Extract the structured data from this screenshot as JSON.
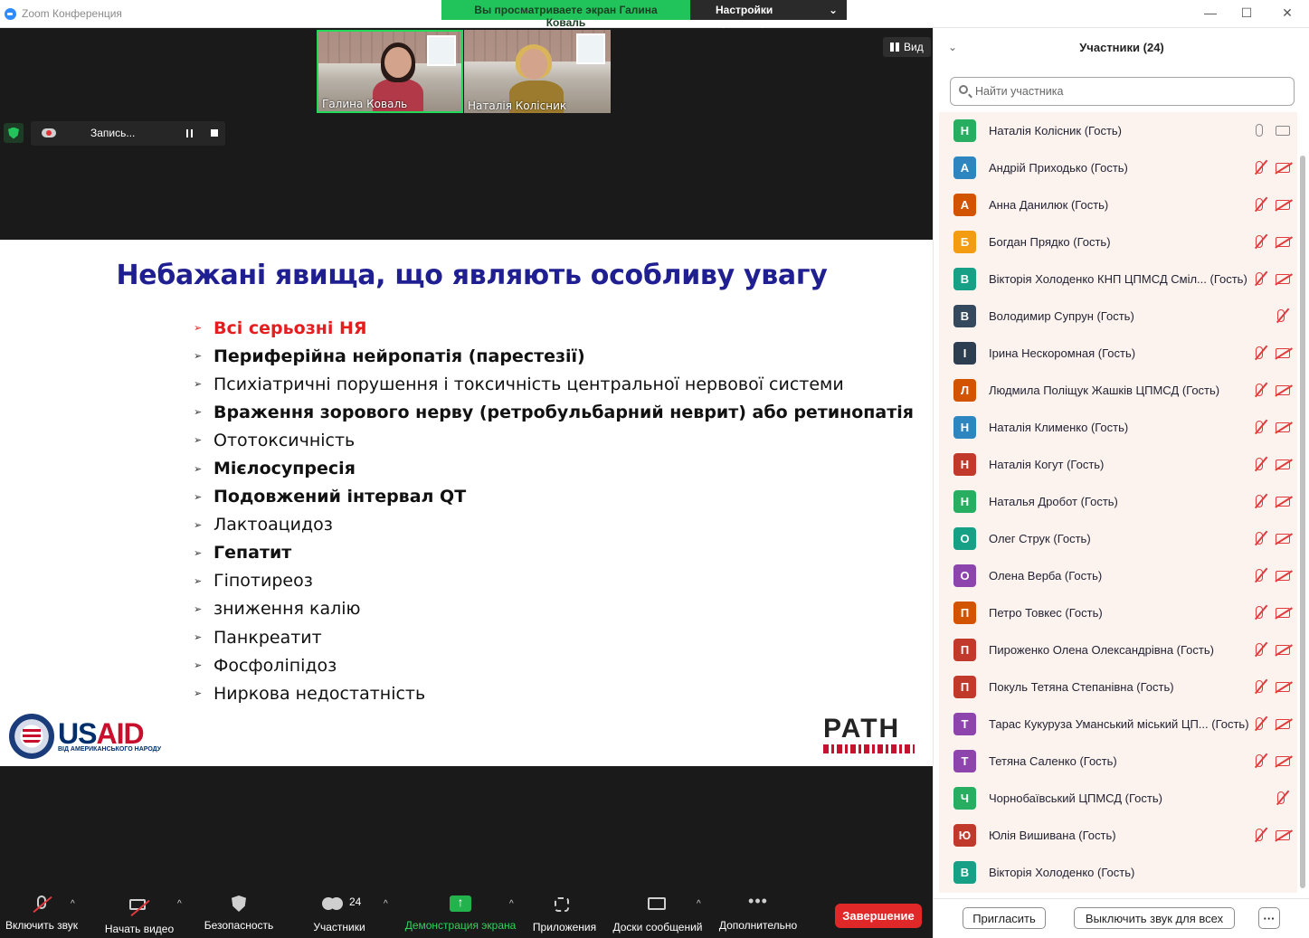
{
  "window": {
    "title": "Zoom Конференция",
    "share_banner": "Вы просматриваете экран Галина Коваль",
    "view_settings": "Настройки просмотра",
    "controls": {
      "minimize": "—",
      "maximize": "☐",
      "close": "✕"
    }
  },
  "video": {
    "view_label": "Вид",
    "thumbnails": [
      {
        "name": "Галина Коваль",
        "active": true
      },
      {
        "name": "Наталія Колісник",
        "active": false
      }
    ],
    "recording": {
      "label": "Запись..."
    }
  },
  "slide": {
    "title": "Небажані явища, що являють особливу увагу",
    "bullet": "➢",
    "items": [
      {
        "text": "Всі серьозні НЯ",
        "style": "red"
      },
      {
        "text": "Периферійна нейропатія (парестезії)",
        "style": "bold"
      },
      {
        "text": "Психіатричні порушення і токсичність центральної нервової системи",
        "style": "normal"
      },
      {
        "text": "Враження зорового нерву (ретробульбарний неврит) або ретинопатія",
        "style": "bold"
      },
      {
        "text": "Ототоксичність",
        "style": "normal"
      },
      {
        "text": "Мієлосупресія",
        "style": "bold"
      },
      {
        "text": "Подовжений інтервал QT",
        "style": "bold"
      },
      {
        "text": "Лактоацидоз",
        "style": "normal"
      },
      {
        "text": "Гепатит",
        "style": "bold"
      },
      {
        "text": "Гіпотиреоз",
        "style": "normal"
      },
      {
        "text": "зниження калію",
        "style": "normal"
      },
      {
        "text": "Панкреатит",
        "style": "normal"
      },
      {
        "text": "Фосфоліпідоз",
        "style": "normal"
      },
      {
        "text": "Ниркова недостатність",
        "style": "normal"
      }
    ],
    "usaid": {
      "word_a": "US",
      "word_b": "AID",
      "sub": "ВІД АМЕРИКАНСЬКОГО НАРОДУ"
    },
    "path": {
      "word": "PATH"
    }
  },
  "toolbar": {
    "unmute": "Включить звук",
    "start_video": "Начать видео",
    "security": "Безопасность",
    "participants": "Участники",
    "participants_count": "24",
    "share": "Демонстрация экрана",
    "apps": "Приложения",
    "whiteboards": "Доски сообщений",
    "more": "Дополнительно",
    "end": "Завершение"
  },
  "panel": {
    "title": "Участники (24)",
    "search_placeholder": "Найти участника",
    "invite": "Пригласить",
    "mute_all": "Выключить звук для всех",
    "more": "···",
    "participants": [
      {
        "initial": "Н",
        "name": "Наталія Колісник (Гость)",
        "color": "#27ae60",
        "muted": false,
        "video": true
      },
      {
        "initial": "А",
        "name": "Андрій Приходько (Гость)",
        "color": "#2e86c1",
        "muted": true,
        "video": true
      },
      {
        "initial": "А",
        "name": "Анна Данилюк (Гость)",
        "color": "#d35400",
        "muted": true,
        "video": true
      },
      {
        "initial": "Б",
        "name": "Богдан Прядко (Гость)",
        "color": "#f39c12",
        "muted": true,
        "video": true
      },
      {
        "initial": "В",
        "name": "Вікторія Холоденко КНП ЦПМСД Сміл...  (Гость)",
        "color": "#16a085",
        "muted": true,
        "video": true
      },
      {
        "initial": "В",
        "name": "Володимир Супрун (Гость)",
        "color": "#34495e",
        "muted": true,
        "video": false
      },
      {
        "initial": "І",
        "name": "Ірина Нескоромная (Гость)",
        "color": "#2c3e50",
        "muted": true,
        "video": true
      },
      {
        "initial": "Л",
        "name": "Людмила Поліщук Жашків ЦПМСД (Гость)",
        "color": "#d35400",
        "muted": true,
        "video": true
      },
      {
        "initial": "Н",
        "name": "Наталія Клименко (Гость)",
        "color": "#2e86c1",
        "muted": true,
        "video": true
      },
      {
        "initial": "Н",
        "name": "Наталія Когут (Гость)",
        "color": "#c0392b",
        "muted": true,
        "video": true
      },
      {
        "initial": "Н",
        "name": "Наталья Дробот (Гость)",
        "color": "#27ae60",
        "muted": true,
        "video": true
      },
      {
        "initial": "О",
        "name": "Олег Струк (Гость)",
        "color": "#16a085",
        "muted": true,
        "video": true
      },
      {
        "initial": "О",
        "name": "Олена Верба (Гость)",
        "color": "#8e44ad",
        "muted": true,
        "video": true
      },
      {
        "initial": "П",
        "name": "Петро Товкес (Гость)",
        "color": "#d35400",
        "muted": true,
        "video": true
      },
      {
        "initial": "П",
        "name": "Пироженко Олена Олександрівна (Гость)",
        "color": "#c0392b",
        "muted": true,
        "video": true
      },
      {
        "initial": "П",
        "name": "Покуль Тетяна Степанівна (Гость)",
        "color": "#c0392b",
        "muted": true,
        "video": true
      },
      {
        "initial": "Т",
        "name": "Тарас Кукуруза Уманський міський ЦП...  (Гость)",
        "color": "#8e44ad",
        "muted": true,
        "video": true
      },
      {
        "initial": "Т",
        "name": "Тетяна Саленко (Гость)",
        "color": "#8e44ad",
        "muted": true,
        "video": true
      },
      {
        "initial": "Ч",
        "name": "Чорнобаївський ЦПМСД (Гость)",
        "color": "#27ae60",
        "muted": true,
        "video": false
      },
      {
        "initial": "Ю",
        "name": "Юлія Вишивана (Гость)",
        "color": "#c0392b",
        "muted": true,
        "video": true
      },
      {
        "initial": "В",
        "name": "Вікторія Холоденко (Гость)",
        "color": "#16a085",
        "muted": false,
        "video": false,
        "no_icons": true
      }
    ]
  }
}
